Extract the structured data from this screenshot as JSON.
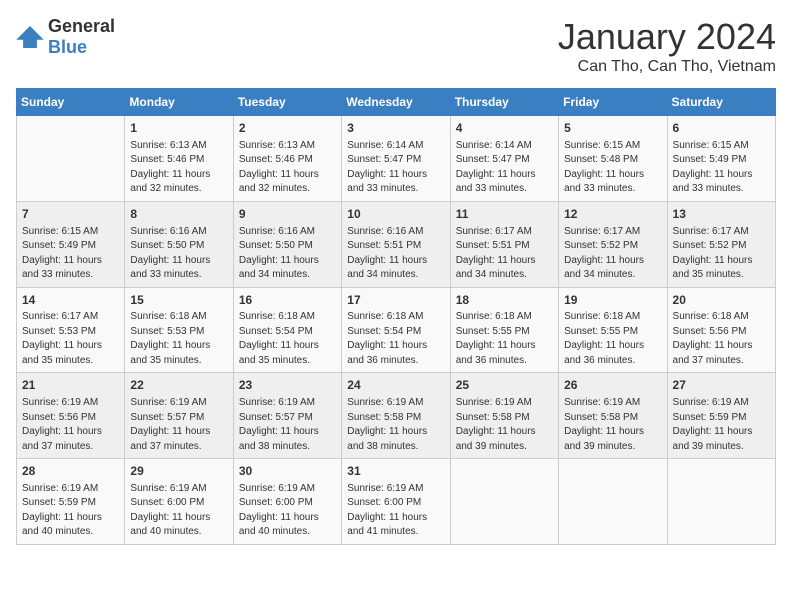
{
  "header": {
    "logo_general": "General",
    "logo_blue": "Blue",
    "month_year": "January 2024",
    "location": "Can Tho, Can Tho, Vietnam"
  },
  "columns": [
    "Sunday",
    "Monday",
    "Tuesday",
    "Wednesday",
    "Thursday",
    "Friday",
    "Saturday"
  ],
  "weeks": [
    [
      {
        "day": "",
        "sunrise": "",
        "sunset": "",
        "daylight": ""
      },
      {
        "day": "1",
        "sunrise": "Sunrise: 6:13 AM",
        "sunset": "Sunset: 5:46 PM",
        "daylight": "Daylight: 11 hours and 32 minutes."
      },
      {
        "day": "2",
        "sunrise": "Sunrise: 6:13 AM",
        "sunset": "Sunset: 5:46 PM",
        "daylight": "Daylight: 11 hours and 32 minutes."
      },
      {
        "day": "3",
        "sunrise": "Sunrise: 6:14 AM",
        "sunset": "Sunset: 5:47 PM",
        "daylight": "Daylight: 11 hours and 33 minutes."
      },
      {
        "day": "4",
        "sunrise": "Sunrise: 6:14 AM",
        "sunset": "Sunset: 5:47 PM",
        "daylight": "Daylight: 11 hours and 33 minutes."
      },
      {
        "day": "5",
        "sunrise": "Sunrise: 6:15 AM",
        "sunset": "Sunset: 5:48 PM",
        "daylight": "Daylight: 11 hours and 33 minutes."
      },
      {
        "day": "6",
        "sunrise": "Sunrise: 6:15 AM",
        "sunset": "Sunset: 5:49 PM",
        "daylight": "Daylight: 11 hours and 33 minutes."
      }
    ],
    [
      {
        "day": "7",
        "sunrise": "Sunrise: 6:15 AM",
        "sunset": "Sunset: 5:49 PM",
        "daylight": "Daylight: 11 hours and 33 minutes."
      },
      {
        "day": "8",
        "sunrise": "Sunrise: 6:16 AM",
        "sunset": "Sunset: 5:50 PM",
        "daylight": "Daylight: 11 hours and 33 minutes."
      },
      {
        "day": "9",
        "sunrise": "Sunrise: 6:16 AM",
        "sunset": "Sunset: 5:50 PM",
        "daylight": "Daylight: 11 hours and 34 minutes."
      },
      {
        "day": "10",
        "sunrise": "Sunrise: 6:16 AM",
        "sunset": "Sunset: 5:51 PM",
        "daylight": "Daylight: 11 hours and 34 minutes."
      },
      {
        "day": "11",
        "sunrise": "Sunrise: 6:17 AM",
        "sunset": "Sunset: 5:51 PM",
        "daylight": "Daylight: 11 hours and 34 minutes."
      },
      {
        "day": "12",
        "sunrise": "Sunrise: 6:17 AM",
        "sunset": "Sunset: 5:52 PM",
        "daylight": "Daylight: 11 hours and 34 minutes."
      },
      {
        "day": "13",
        "sunrise": "Sunrise: 6:17 AM",
        "sunset": "Sunset: 5:52 PM",
        "daylight": "Daylight: 11 hours and 35 minutes."
      }
    ],
    [
      {
        "day": "14",
        "sunrise": "Sunrise: 6:17 AM",
        "sunset": "Sunset: 5:53 PM",
        "daylight": "Daylight: 11 hours and 35 minutes."
      },
      {
        "day": "15",
        "sunrise": "Sunrise: 6:18 AM",
        "sunset": "Sunset: 5:53 PM",
        "daylight": "Daylight: 11 hours and 35 minutes."
      },
      {
        "day": "16",
        "sunrise": "Sunrise: 6:18 AM",
        "sunset": "Sunset: 5:54 PM",
        "daylight": "Daylight: 11 hours and 35 minutes."
      },
      {
        "day": "17",
        "sunrise": "Sunrise: 6:18 AM",
        "sunset": "Sunset: 5:54 PM",
        "daylight": "Daylight: 11 hours and 36 minutes."
      },
      {
        "day": "18",
        "sunrise": "Sunrise: 6:18 AM",
        "sunset": "Sunset: 5:55 PM",
        "daylight": "Daylight: 11 hours and 36 minutes."
      },
      {
        "day": "19",
        "sunrise": "Sunrise: 6:18 AM",
        "sunset": "Sunset: 5:55 PM",
        "daylight": "Daylight: 11 hours and 36 minutes."
      },
      {
        "day": "20",
        "sunrise": "Sunrise: 6:18 AM",
        "sunset": "Sunset: 5:56 PM",
        "daylight": "Daylight: 11 hours and 37 minutes."
      }
    ],
    [
      {
        "day": "21",
        "sunrise": "Sunrise: 6:19 AM",
        "sunset": "Sunset: 5:56 PM",
        "daylight": "Daylight: 11 hours and 37 minutes."
      },
      {
        "day": "22",
        "sunrise": "Sunrise: 6:19 AM",
        "sunset": "Sunset: 5:57 PM",
        "daylight": "Daylight: 11 hours and 37 minutes."
      },
      {
        "day": "23",
        "sunrise": "Sunrise: 6:19 AM",
        "sunset": "Sunset: 5:57 PM",
        "daylight": "Daylight: 11 hours and 38 minutes."
      },
      {
        "day": "24",
        "sunrise": "Sunrise: 6:19 AM",
        "sunset": "Sunset: 5:58 PM",
        "daylight": "Daylight: 11 hours and 38 minutes."
      },
      {
        "day": "25",
        "sunrise": "Sunrise: 6:19 AM",
        "sunset": "Sunset: 5:58 PM",
        "daylight": "Daylight: 11 hours and 39 minutes."
      },
      {
        "day": "26",
        "sunrise": "Sunrise: 6:19 AM",
        "sunset": "Sunset: 5:58 PM",
        "daylight": "Daylight: 11 hours and 39 minutes."
      },
      {
        "day": "27",
        "sunrise": "Sunrise: 6:19 AM",
        "sunset": "Sunset: 5:59 PM",
        "daylight": "Daylight: 11 hours and 39 minutes."
      }
    ],
    [
      {
        "day": "28",
        "sunrise": "Sunrise: 6:19 AM",
        "sunset": "Sunset: 5:59 PM",
        "daylight": "Daylight: 11 hours and 40 minutes."
      },
      {
        "day": "29",
        "sunrise": "Sunrise: 6:19 AM",
        "sunset": "Sunset: 6:00 PM",
        "daylight": "Daylight: 11 hours and 40 minutes."
      },
      {
        "day": "30",
        "sunrise": "Sunrise: 6:19 AM",
        "sunset": "Sunset: 6:00 PM",
        "daylight": "Daylight: 11 hours and 40 minutes."
      },
      {
        "day": "31",
        "sunrise": "Sunrise: 6:19 AM",
        "sunset": "Sunset: 6:00 PM",
        "daylight": "Daylight: 11 hours and 41 minutes."
      },
      {
        "day": "",
        "sunrise": "",
        "sunset": "",
        "daylight": ""
      },
      {
        "day": "",
        "sunrise": "",
        "sunset": "",
        "daylight": ""
      },
      {
        "day": "",
        "sunrise": "",
        "sunset": "",
        "daylight": ""
      }
    ]
  ]
}
